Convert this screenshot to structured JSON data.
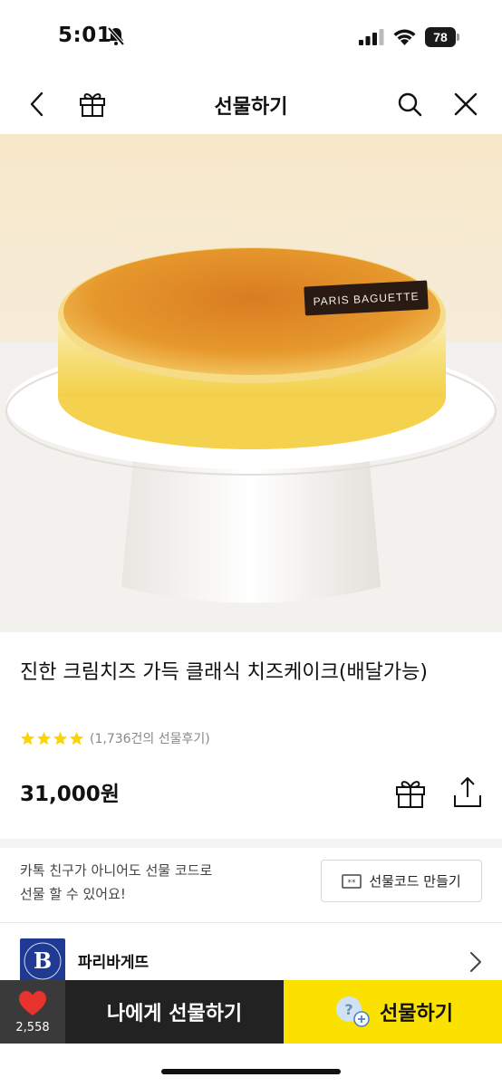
{
  "status_bar": {
    "time": "5:01",
    "battery": "78",
    "icons": [
      "bell-muted-icon",
      "signal-icon",
      "wifi-icon",
      "battery-icon"
    ]
  },
  "header": {
    "title": "선물하기",
    "icons": [
      "back-icon",
      "gift-box-icon",
      "search-icon",
      "close-icon"
    ]
  },
  "hero": {
    "plaque_text": "PARIS BAGUETTE"
  },
  "product": {
    "title": "진한 크림치즈 가득 클래식 치즈케이크(배달가능)",
    "rating_stars": 4,
    "review_text": "(1,736건의 선물후기)",
    "price": "31,000원"
  },
  "gift_code": {
    "text_line1": "카톡 친구가 아니어도 선물 코드로",
    "text_line2": "선물 할 수 있어요!",
    "button_label": "선물코드 만들기"
  },
  "brand": {
    "name": "파리바게뜨",
    "logo_letter": "B"
  },
  "bottom_bar": {
    "like_count": "2,558",
    "self_gift_label": "나에게 선물하기",
    "gift_label": "선물하기"
  },
  "colors": {
    "kakao_yellow": "#fae100",
    "dark_button": "#222222",
    "heart_red": "#e8322d",
    "star_yellow": "#fcd400",
    "brand_blue": "#1f3a93"
  }
}
